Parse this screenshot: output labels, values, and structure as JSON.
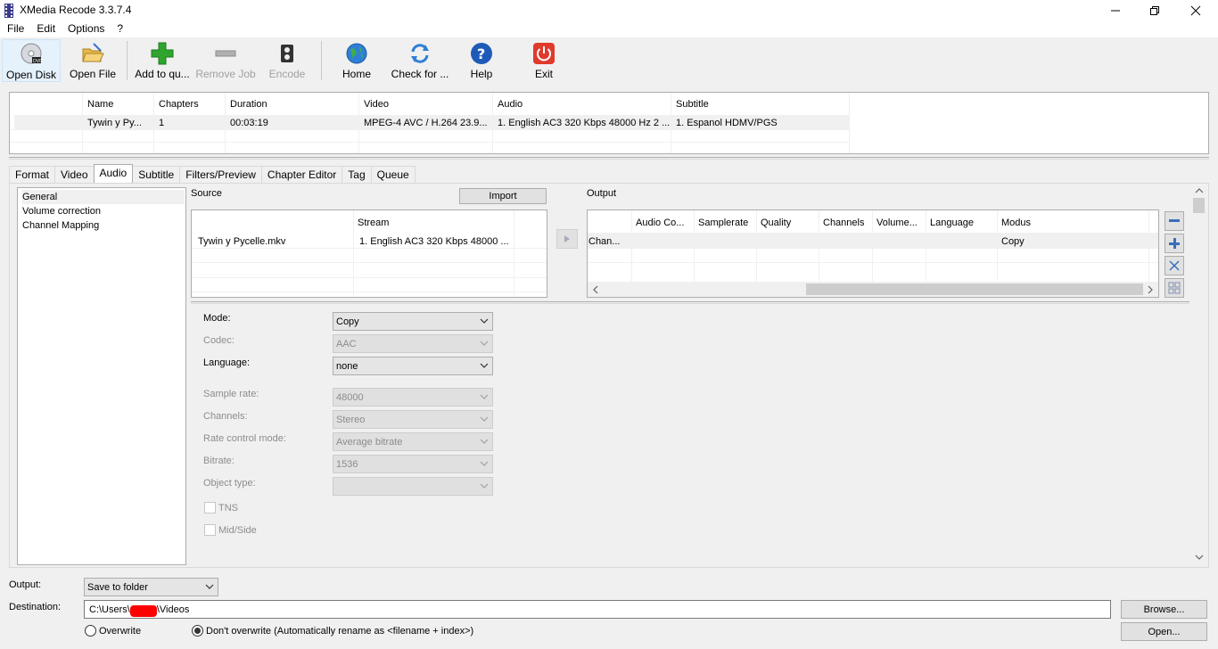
{
  "window": {
    "title": "XMedia Recode 3.3.7.4"
  },
  "menu": [
    "File",
    "Edit",
    "Options",
    "?"
  ],
  "toolbar": {
    "open_disk": "Open Disk",
    "open_file": "Open File",
    "add_to_queue": "Add to qu...",
    "remove_job": "Remove Job",
    "encode": "Encode",
    "home": "Home",
    "check_for": "Check for ...",
    "help": "Help",
    "exit": "Exit"
  },
  "file_list": {
    "headers": [
      "Name",
      "Chapters",
      "Duration",
      "Video",
      "Audio",
      "Subtitle"
    ],
    "row": [
      "Tywin y Py...",
      "1",
      "00:03:19",
      "MPEG-4 AVC / H.264 23.9...",
      "1. English AC3 320 Kbps 48000 Hz 2 ...",
      "1. Espanol HDMV/PGS"
    ]
  },
  "tabs": [
    "Format",
    "Video",
    "Audio",
    "Subtitle",
    "Filters/Preview",
    "Chapter Editor",
    "Tag",
    "Queue"
  ],
  "nav": [
    "General",
    "Volume correction",
    "Channel Mapping"
  ],
  "source": {
    "label": "Source",
    "import": "Import",
    "header_stream": "Stream",
    "file": "Tywin y Pycelle.mkv",
    "stream": "1. English AC3 320 Kbps 48000 ..."
  },
  "output_panel": {
    "label": "Output",
    "headers": [
      "Audio Co...",
      "Samplerate",
      "Quality",
      "Channels",
      "Volume...",
      "Language",
      "Modus"
    ],
    "row_first": "Chan...",
    "row_modus": "Copy"
  },
  "settings": {
    "mode_label": "Mode:",
    "mode_value": "Copy",
    "codec_label": "Codec:",
    "codec_value": "AAC",
    "language_label": "Language:",
    "language_value": "none",
    "samplerate_label": "Sample rate:",
    "samplerate_value": "48000",
    "channels_label": "Channels:",
    "channels_value": "Stereo",
    "rate_label": "Rate control mode:",
    "rate_value": "Average bitrate",
    "bitrate_label": "Bitrate:",
    "bitrate_value": "1536",
    "object_label": "Object type:",
    "object_value": "",
    "tns_label": "TNS",
    "midside_label": "Mid/Side"
  },
  "bottom": {
    "output_label": "Output:",
    "output_value": "Save to folder",
    "destination_label": "Destination:",
    "destination_prefix": "C:\\Users\\",
    "destination_suffix": "\\Videos",
    "browse": "Browse...",
    "open": "Open...",
    "overwrite": "Overwrite",
    "dont_overwrite": "Don't overwrite (Automatically rename as <filename + index>)"
  },
  "colors": {
    "accent_green": "#2fa52f",
    "help_blue": "#1e5bb8",
    "exit_red": "#e03a2c",
    "redact": "#ff0000"
  }
}
